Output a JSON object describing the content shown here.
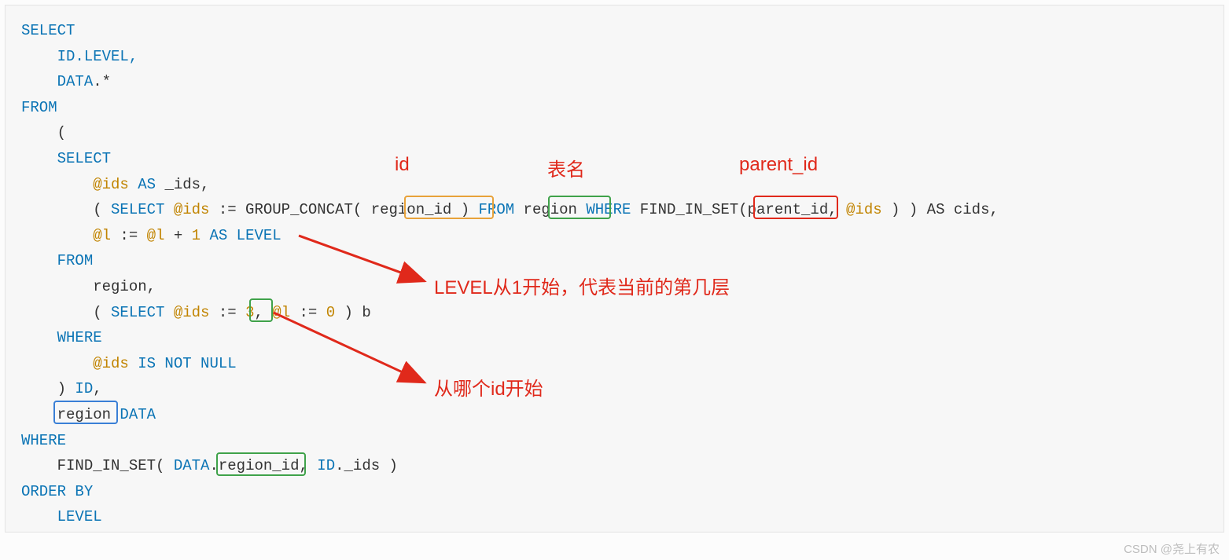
{
  "code": {
    "l1": "SELECT",
    "l2a": "ID",
    "l2b": ".LEVEL,",
    "l3a": "DATA",
    "l3b": ".*",
    "l4": "FROM",
    "l5": "(",
    "l6": "SELECT",
    "l7a": "@ids",
    "l7b": " AS ",
    "l7c": "_ids",
    "l7d": ",",
    "l8a": "(",
    "l8b": " SELECT ",
    "l8c": "@ids",
    "l8d": " := GROUP_CONCAT( ",
    "l8e": "region_id",
    "l8f": " ) ",
    "l8g": "FROM",
    "l8h": " region ",
    "l8i": "WHERE",
    "l8j": " FIND_IN_SET(",
    "l8k": "parent_id",
    "l8l": ", ",
    "l8m": "@ids",
    "l8n": " ) ) AS cids,",
    "l9a": "@l",
    "l9b": " := ",
    "l9c": "@l",
    "l9d": " + ",
    "l9e": "1",
    "l9f": " AS LEVEL",
    "l10": "FROM",
    "l11a": "region",
    "l11b": ",",
    "l12a": "(",
    "l12b": " SELECT ",
    "l12c": "@ids",
    "l12d": " :=",
    "l12e": " 3",
    "l12f": ", ",
    "l12g": "@l",
    "l12h": " := ",
    "l12i": "0",
    "l12j": " ) b",
    "l13": "WHERE",
    "l14a": "@ids",
    "l14b": " IS NOT NULL",
    "l15a": ") ",
    "l15b": "ID",
    "l15c": ",",
    "l16a": "region",
    "l16b": " DATA",
    "l17": "WHERE",
    "l18a": "FIND_IN_SET( ",
    "l18b": "DATA",
    "l18c": ".",
    "l18d": "region_id",
    "l18e": ", ",
    "l18f": "ID",
    "l18g": "._ids )",
    "l19": "ORDER BY",
    "l20": "LEVEL"
  },
  "annot": {
    "id": "id",
    "tablename": "表名",
    "parentid": "parent_id",
    "level_note": "LEVEL从1开始，代表当前的第几层",
    "start_note": "从哪个id开始"
  },
  "watermark": "CSDN @尧上有农"
}
